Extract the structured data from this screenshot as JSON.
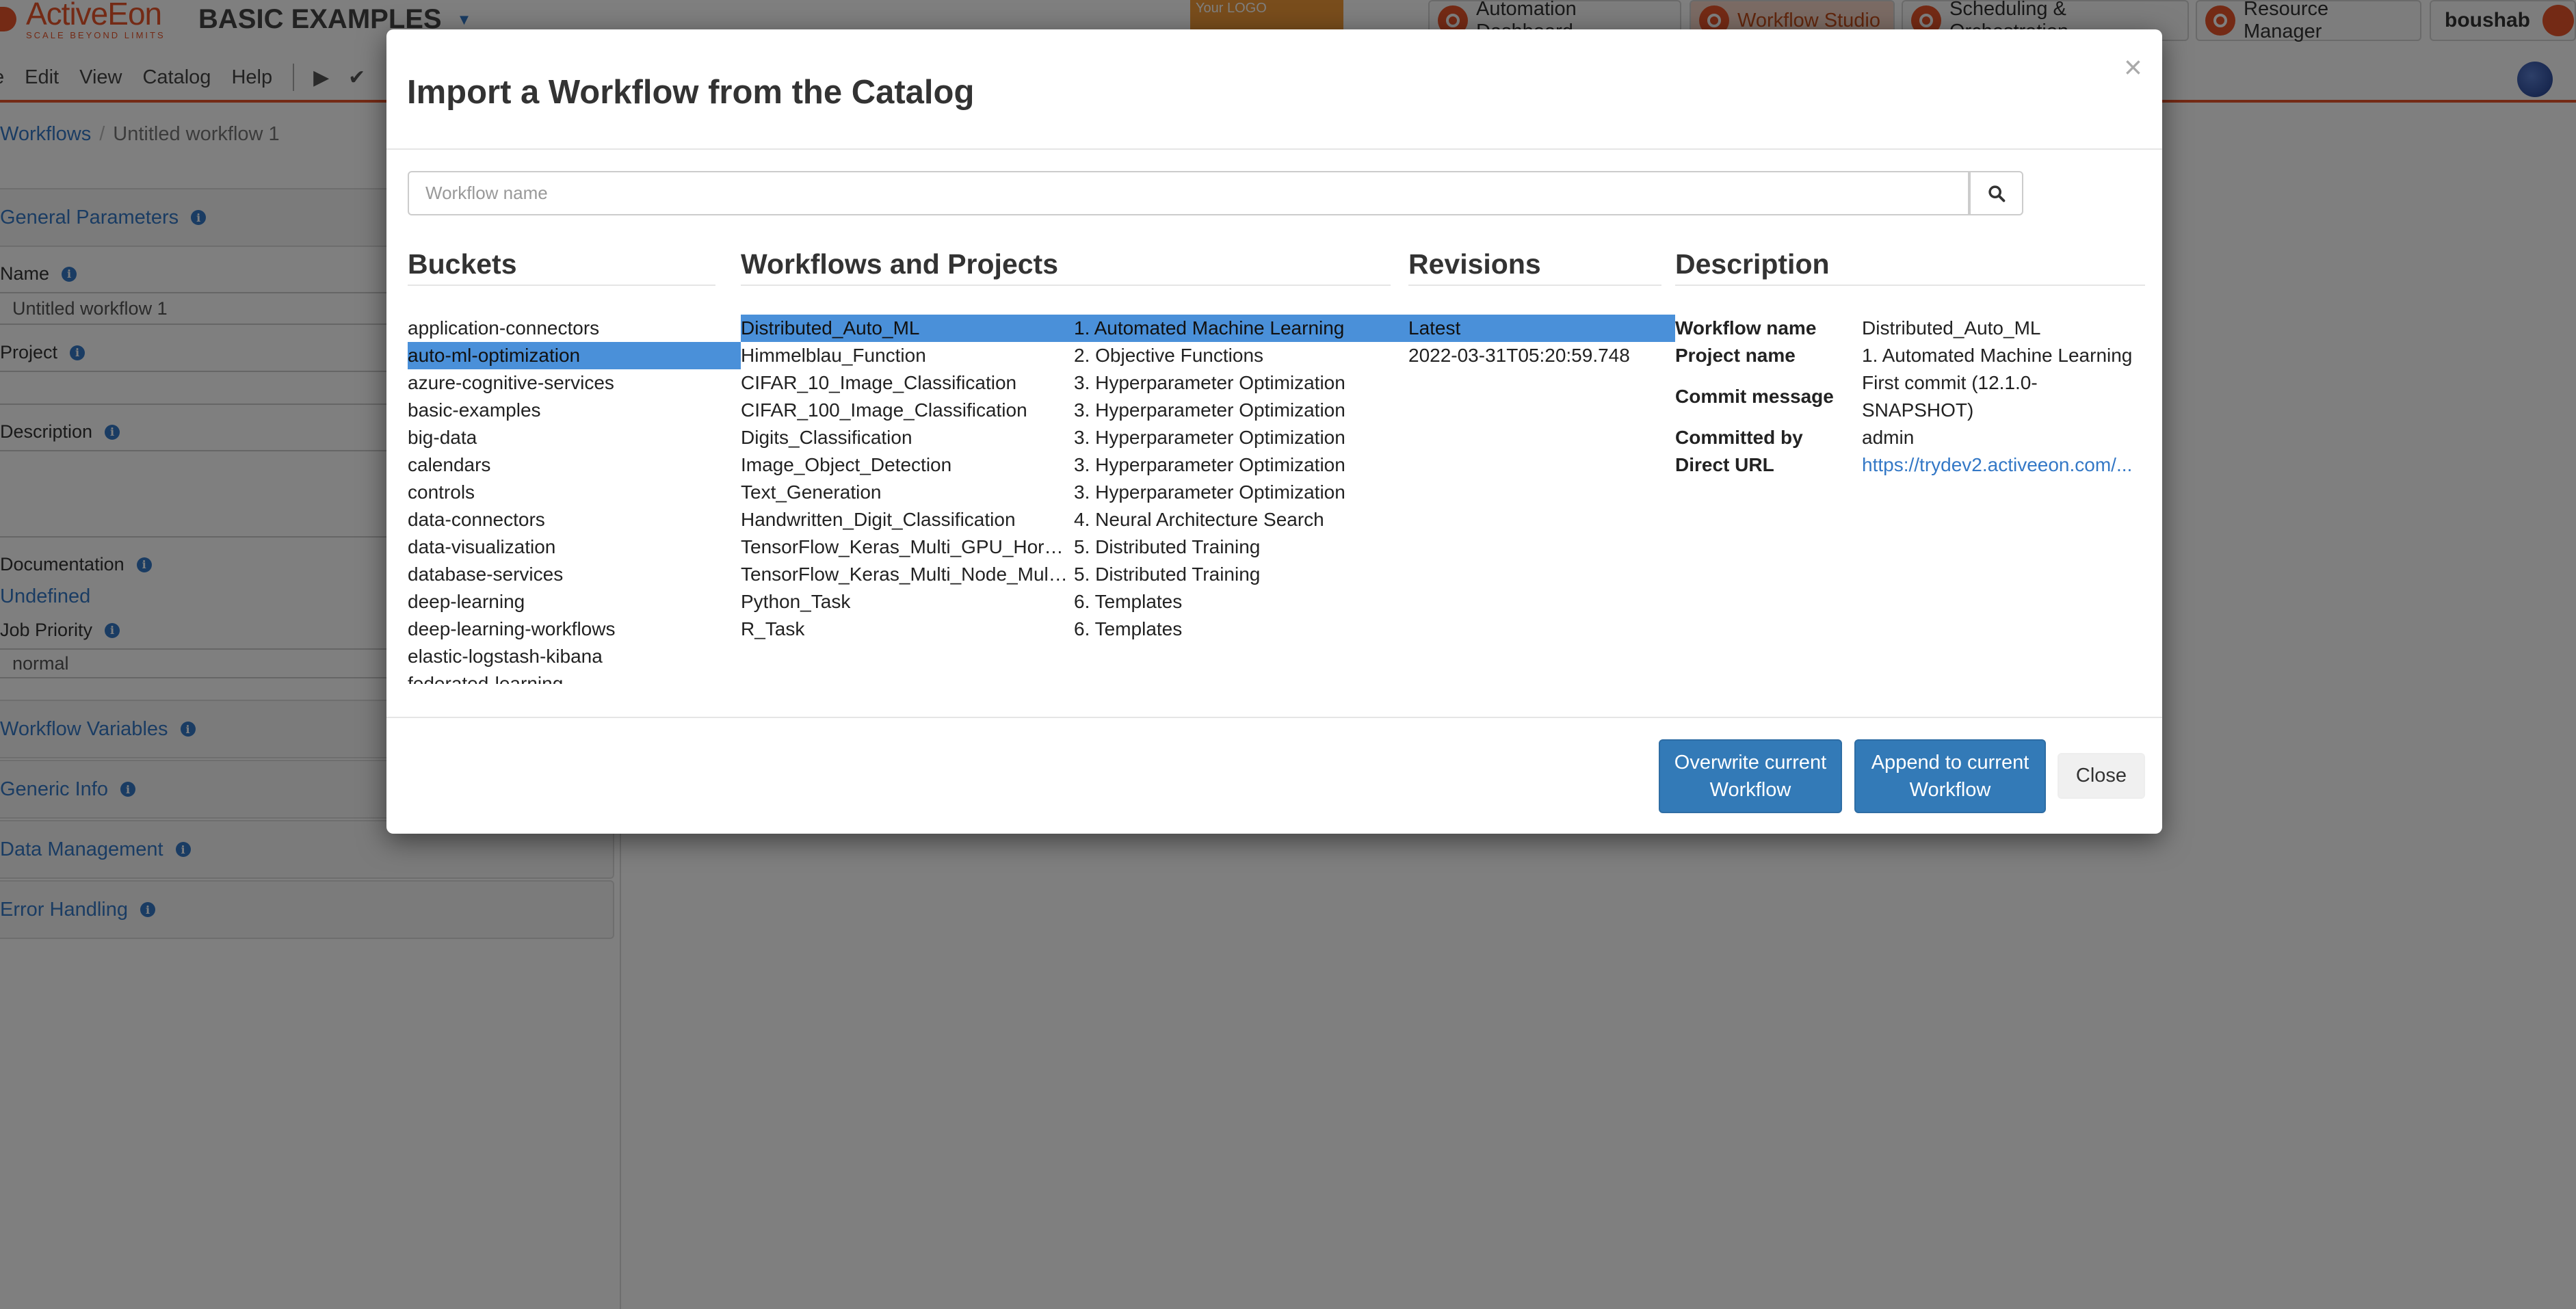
{
  "header": {
    "logo_name": "ActiveEon",
    "logo_tagline": "SCALE BEYOND LIMITS",
    "project_title": "BASIC EXAMPLES",
    "your_logo": "Your LOGO",
    "portals": [
      {
        "label": "Automation Dashboard"
      },
      {
        "label": "Workflow Studio"
      },
      {
        "label": "Scheduling & Orchestration"
      },
      {
        "label": "Resource Manager"
      }
    ],
    "user": "boushab"
  },
  "menu": {
    "items": [
      "e",
      "Edit",
      "View",
      "Catalog",
      "Help"
    ]
  },
  "breadcrumb": {
    "root": "Workflows",
    "separator": "/",
    "current": "Untitled workflow 1"
  },
  "left_panel": {
    "general_parameters": "General Parameters",
    "name_label": "Name",
    "name_value": "Untitled workflow 1",
    "project_label": "Project",
    "description_label": "Description",
    "documentation_label": "Documentation",
    "documentation_value": "Undefined",
    "job_priority_label": "Job Priority",
    "job_priority_value": "normal",
    "workflow_variables": "Workflow Variables",
    "generic_info": "Generic Info",
    "data_management": "Data Management",
    "error_handling": "Error Handling"
  },
  "modal": {
    "title": "Import a Workflow from the Catalog",
    "close_x": "×",
    "search_placeholder": "Workflow name",
    "headers": {
      "buckets": "Buckets",
      "workflows": "Workflows and Projects",
      "revisions": "Revisions",
      "description": "Description"
    },
    "buckets": [
      "application-connectors",
      "auto-ml-optimization",
      "azure-cognitive-services",
      "basic-examples",
      "big-data",
      "calendars",
      "controls",
      "data-connectors",
      "data-visualization",
      "database-services",
      "deep-learning",
      "deep-learning-workflows",
      "elastic-logstash-kibana",
      "federated-learning"
    ],
    "workflows": [
      {
        "name": "Distributed_Auto_ML",
        "project": "1. Automated Machine Learning"
      },
      {
        "name": "Himmelblau_Function",
        "project": "2. Objective Functions"
      },
      {
        "name": "CIFAR_10_Image_Classification",
        "project": "3. Hyperparameter Optimization"
      },
      {
        "name": "CIFAR_100_Image_Classification",
        "project": "3. Hyperparameter Optimization"
      },
      {
        "name": "Digits_Classification",
        "project": "3. Hyperparameter Optimization"
      },
      {
        "name": "Image_Object_Detection",
        "project": "3. Hyperparameter Optimization"
      },
      {
        "name": "Text_Generation",
        "project": "3. Hyperparameter Optimization"
      },
      {
        "name": "Handwritten_Digit_Classification",
        "project": "4. Neural Architecture Search"
      },
      {
        "name": "TensorFlow_Keras_Multi_GPU_Horovod",
        "project": "5. Distributed Training"
      },
      {
        "name": "TensorFlow_Keras_Multi_Node_Multi_GPU",
        "project": "5. Distributed Training"
      },
      {
        "name": "Python_Task",
        "project": "6. Templates"
      },
      {
        "name": "R_Task",
        "project": "6. Templates"
      }
    ],
    "revisions": [
      "Latest",
      "2022-03-31T05:20:59.748"
    ],
    "description": {
      "workflow_name_label": "Workflow name",
      "workflow_name": "Distributed_Auto_ML",
      "project_name_label": "Project name",
      "project_name": "1. Automated Machine Learning",
      "commit_message_label": "Commit message",
      "commit_message": "First commit (12.1.0-SNAPSHOT)",
      "committed_by_label": "Committed by",
      "committed_by": "admin",
      "direct_url_label": "Direct URL",
      "direct_url": "https://trydev2.activeeon.com/..."
    },
    "buttons": {
      "overwrite": "Overwrite current Workflow",
      "append": "Append to current Workflow",
      "close": "Close"
    }
  }
}
